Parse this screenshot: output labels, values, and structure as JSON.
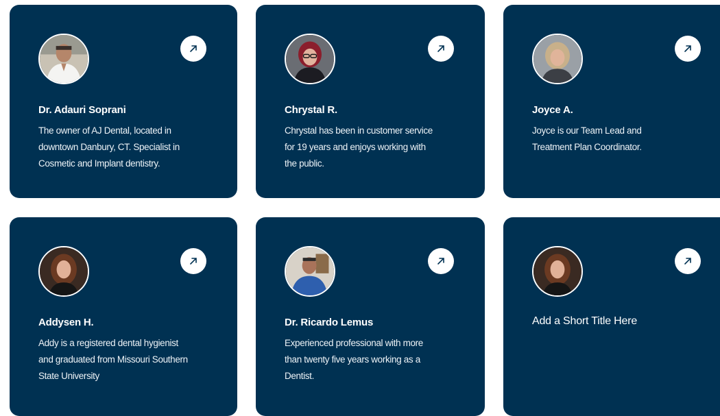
{
  "team": [
    {
      "name": "Dr. Adauri Soprani",
      "description": [
        "The owner of AJ Dental, located in",
        "downtown Danbury, CT. Specialist in",
        "Cosmetic and Implant dentistry."
      ]
    },
    {
      "name": "Chrystal R.",
      "description": [
        "Chrystal has been in customer service",
        "for 19 years and enjoys working with",
        "the public."
      ]
    },
    {
      "name": "Joyce A.",
      "description": [
        "Joyce is our Team Lead and",
        "Treatment Plan Coordinator."
      ]
    },
    {
      "name": "Addysen H.",
      "description": [
        "Addy is a registered dental hygienist",
        "and graduated from Missouri Southern",
        "State University"
      ]
    },
    {
      "name": "Dr. Ricardo Lemus",
      "description": [
        "Experienced professional with more",
        "than twenty five years working as a",
        "Dentist."
      ]
    },
    {
      "name": "Add a Short Title Here",
      "description": []
    }
  ],
  "colors": {
    "card_background": "#003152",
    "text": "#ffffff",
    "button_background": "#ffffff",
    "button_icon": "#003152"
  },
  "icons": {
    "link": "arrow-up-right-icon"
  }
}
